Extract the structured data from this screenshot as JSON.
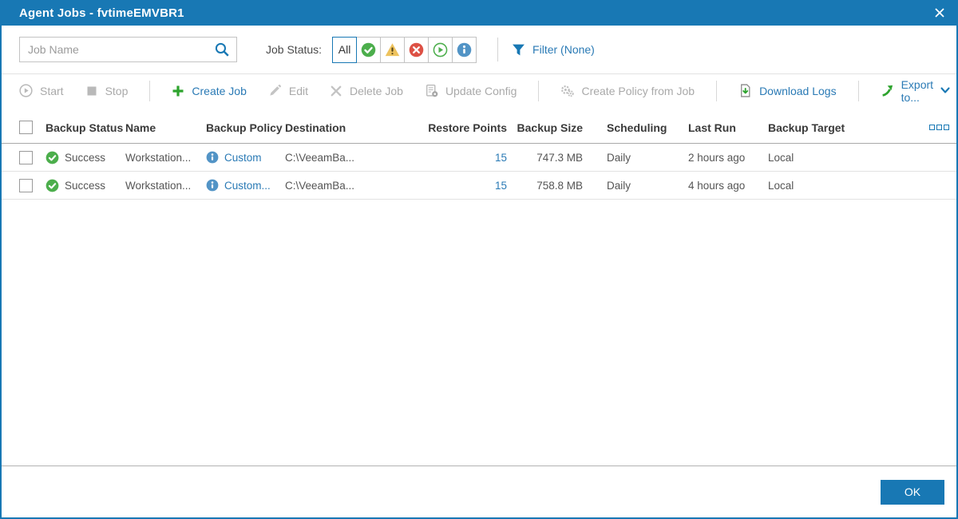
{
  "window": {
    "title": "Agent Jobs - fvtimeEMVBR1"
  },
  "filters": {
    "search_placeholder": "Job Name",
    "job_status_label": "Job Status:",
    "status_all_label": "All",
    "status_icons": [
      "success",
      "warning",
      "error",
      "running",
      "info"
    ],
    "filter_label": "Filter (None)"
  },
  "toolbar": {
    "start": "Start",
    "stop": "Stop",
    "create_job": "Create Job",
    "edit": "Edit",
    "delete_job": "Delete Job",
    "update_config": "Update Config",
    "create_policy": "Create Policy from Job",
    "download_logs": "Download Logs",
    "export_to": "Export to..."
  },
  "table": {
    "headers": {
      "backup_status": "Backup Status",
      "name": "Name",
      "backup_policy": "Backup Policy",
      "destination": "Destination",
      "restore_points": "Restore Points",
      "backup_size": "Backup Size",
      "scheduling": "Scheduling",
      "last_run": "Last Run",
      "backup_target": "Backup Target"
    },
    "rows": [
      {
        "backup_status": "Success",
        "name": "Workstation...",
        "backup_policy": "Custom",
        "destination": "C:\\VeeamBa...",
        "restore_points": "15",
        "backup_size": "747.3 MB",
        "scheduling": "Daily",
        "last_run": "2 hours ago",
        "backup_target": "Local"
      },
      {
        "backup_status": "Success",
        "name": "Workstation...",
        "backup_policy": "Custom...",
        "destination": "C:\\VeeamBa...",
        "restore_points": "15",
        "backup_size": "758.8 MB",
        "scheduling": "Daily",
        "last_run": "4 hours ago",
        "backup_target": "Local"
      }
    ]
  },
  "footer": {
    "ok_label": "OK"
  },
  "colors": {
    "titlebar": "#1878b4",
    "accent_blue": "#2a7ab5",
    "success_green": "#4cae4c",
    "warning_amber": "#eec35e",
    "error_red": "#dd5145",
    "info_blue": "#5294c6",
    "create_green": "#2da32d",
    "disabled_gray": "#b9b9b9"
  }
}
